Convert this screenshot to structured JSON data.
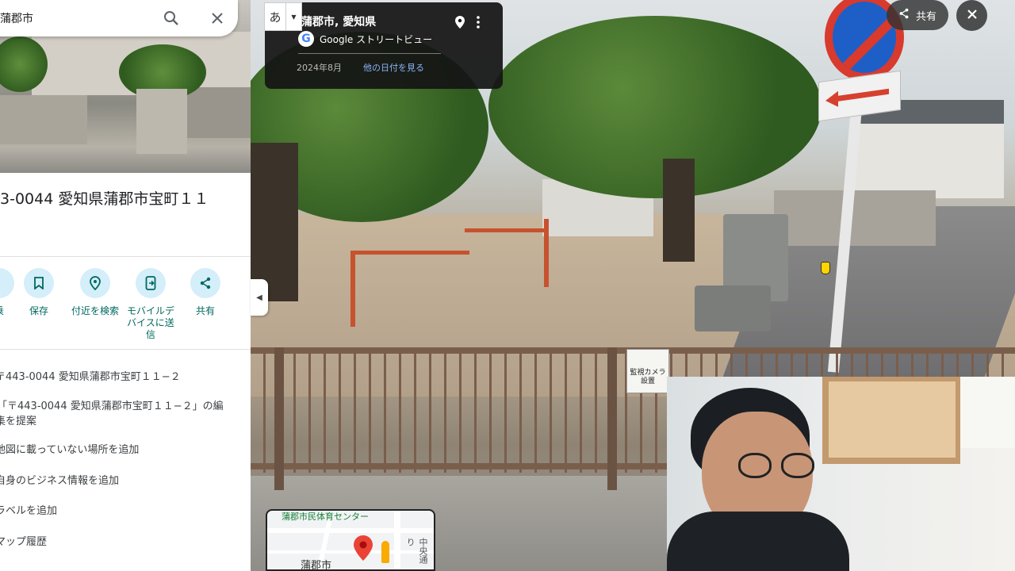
{
  "search": {
    "value": "蒲郡市",
    "search_icon": "search-icon",
    "close_icon": "close-icon"
  },
  "panel": {
    "title": "3-0044 愛知県蒲郡市宝町１１",
    "actions": [
      {
        "label": "乗",
        "icon": "directions-icon"
      },
      {
        "label": "保存",
        "icon": "bookmark-icon"
      },
      {
        "label": "付近を検索",
        "icon": "nearby-search-icon"
      },
      {
        "label": "モバイルデ\nバイスに送\n信",
        "icon": "send-to-phone-icon"
      },
      {
        "label": "共有",
        "icon": "share-icon"
      }
    ],
    "menu": [
      "〒443-0044 愛知県蒲郡市宝町１１−２",
      "「〒443-0044 愛知県蒲郡市宝町１１−２」の編",
      "集を提案",
      "地図に載っていない場所を追加",
      "自身のビジネス情報を追加",
      "ラベルを追加",
      "マップ履歴"
    ]
  },
  "ime": {
    "char": "あ"
  },
  "streetview": {
    "place": "蒲郡市, 愛知県",
    "brand": "Google ストリートビュー",
    "date": "2024年8月",
    "other_dates": "他の日付を見る",
    "camera_sign": "監視カメラ 設置"
  },
  "controls": {
    "share_label": "共有"
  },
  "minimap": {
    "label_top": "蒲郡市民体育センター",
    "label_city": "蒲郡市",
    "label_road": "中央通り"
  },
  "colors": {
    "accent": "#00695f",
    "action_bg": "#d4eefa",
    "link": "#8ab4f8",
    "pin": "#ea4335"
  }
}
